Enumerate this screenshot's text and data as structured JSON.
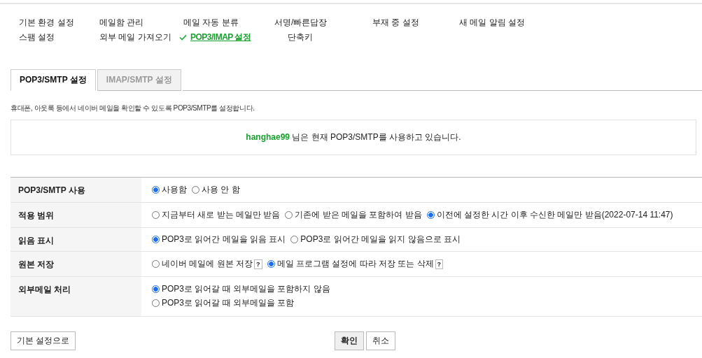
{
  "nav": {
    "rows": [
      [
        {
          "label": "기본 환경 설정",
          "selected": false
        },
        {
          "label": "메일함 관리",
          "selected": false
        },
        {
          "label": "메일 자동 분류",
          "selected": false
        },
        {
          "label": "서명/빠른답장",
          "selected": false
        },
        {
          "label": "부재 중 설정",
          "selected": false
        },
        {
          "label": "새 메일 알림 설정",
          "selected": false
        }
      ],
      [
        {
          "label": "스팸 설정",
          "selected": false
        },
        {
          "label": "외부 메일 가져오기",
          "selected": false
        },
        {
          "label": "POP3/IMAP 설정",
          "selected": true
        },
        {
          "label": "단축키",
          "selected": false
        }
      ]
    ]
  },
  "tabs": [
    {
      "label": "POP3/SMTP 설정",
      "selected": true
    },
    {
      "label": "IMAP/SMTP 설정",
      "selected": false
    }
  ],
  "description": "휴대폰, 아웃룩 등에서 네이버 메일을 확인할 수 있도록 POP3/SMTP를 설정합니다.",
  "status": {
    "user": "hanghae99",
    "message": "님은 현재 POP3/SMTP를 사용하고 있습니다."
  },
  "settings": [
    {
      "label": "POP3/SMTP 사용",
      "kind": "inline",
      "options": [
        {
          "label": "사용함",
          "selected": true
        },
        {
          "label": "사용 안 함",
          "selected": false
        }
      ]
    },
    {
      "label": "적용 범위",
      "kind": "inline",
      "options": [
        {
          "label": "지금부터 새로 받는 메일만 받음",
          "selected": false
        },
        {
          "label": "기존에 받은 메일을 포함하여 받음",
          "selected": false
        },
        {
          "label": "이전에 설정한 시간 이후 수신한 메일만 받음(2022-07-14 11:47)",
          "selected": true
        }
      ]
    },
    {
      "label": "읽음 표시",
      "kind": "inline",
      "options": [
        {
          "label": "POP3로 읽어간 메일을 읽음 표시",
          "selected": true
        },
        {
          "label": "POP3로 읽어간 메일을 읽지 않음으로 표시",
          "selected": false
        }
      ]
    },
    {
      "label": "원본 저장",
      "kind": "inline",
      "options": [
        {
          "label": "네이버 메일에 원본 저장",
          "selected": false,
          "help": "?"
        },
        {
          "label": "메일 프로그램 설정에 따라 저장 또는 삭제",
          "selected": true,
          "help": "?"
        }
      ]
    },
    {
      "label": "외부메일 처리",
      "kind": "stacked",
      "options": [
        {
          "label": "POP3로 읽어갈 때 외부메일을 포함하지 않음",
          "selected": true
        },
        {
          "label": "POP3로 읽어갈 때 외부메일을 포함",
          "selected": false
        }
      ]
    }
  ],
  "buttons": {
    "reset": "기본 설정으로",
    "confirm": "확인",
    "cancel": "취소"
  }
}
